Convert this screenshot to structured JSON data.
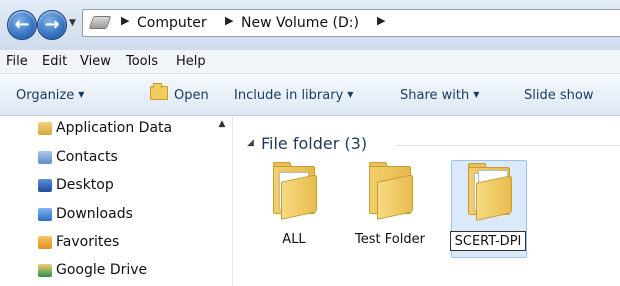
{
  "breadcrumb": {
    "items": [
      "Computer",
      "New Volume (D:)"
    ],
    "separator_glyph": "▶"
  },
  "menu": {
    "items": [
      "File",
      "Edit",
      "View",
      "Tools",
      "Help"
    ]
  },
  "toolbar": {
    "organize": "Organize",
    "open": "Open",
    "include": "Include in library",
    "share": "Share with",
    "slideshow": "Slide show"
  },
  "navpane": {
    "items": [
      "Application Data",
      "Contacts",
      "Desktop",
      "Downloads",
      "Favorites",
      "Google Drive"
    ]
  },
  "content": {
    "group_title": "File folder (3)",
    "folders": [
      {
        "name": "ALL",
        "selected": false
      },
      {
        "name": "Test Folder",
        "selected": false
      },
      {
        "name": "SCERT-DPI",
        "selected": true,
        "renaming": true
      }
    ]
  },
  "colors": {
    "accent": "#1e395b",
    "selection": "#dbeaf9",
    "folder": "#f2cf6b"
  }
}
